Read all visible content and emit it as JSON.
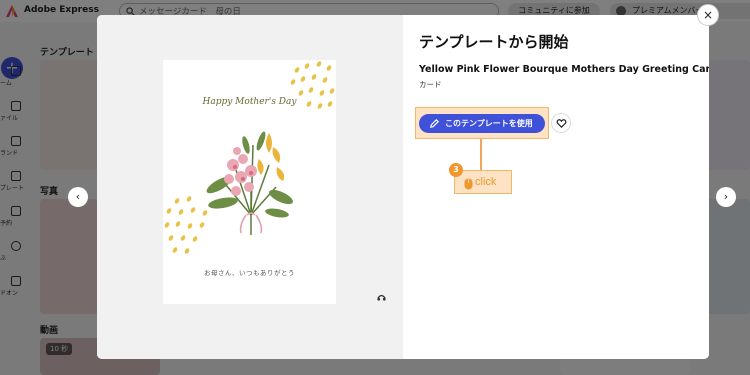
{
  "app": {
    "name": "Adobe Express",
    "search_placeholder": "メッセージカード　母の日",
    "community_label": "コミュニティに参加",
    "premium_label": "プレミアムメンバー",
    "sidebar": {
      "add_label": "+",
      "items": [
        {
          "label": "ホーム",
          "icon": "home-icon"
        },
        {
          "label": "ファイル",
          "icon": "folder-icon"
        },
        {
          "label": "ブランド",
          "icon": "brand-icon"
        },
        {
          "label": "ンプレート",
          "icon": "template-icon"
        },
        {
          "label": "稿予約",
          "icon": "calendar-icon"
        },
        {
          "label": "学ぶ",
          "icon": "bulb-icon"
        },
        {
          "label": "アドオン",
          "icon": "addon-icon"
        }
      ]
    },
    "sections": {
      "templates": "テンプレート",
      "photos": "写真",
      "videos": "動画",
      "video_badge": "10 秒"
    }
  },
  "modal": {
    "heading": "テンプレートから開始",
    "template_name": "Yellow Pink Flower Bourque Mothers Day Greeting Card",
    "template_type": "カード",
    "use_button_label": "このテンプレートを使用",
    "card": {
      "title": "Happy Mother's Day",
      "subtitle": "お母さん、いつもありがとう"
    },
    "close_label": "×",
    "prev_label": "‹",
    "next_label": "›"
  },
  "annotation": {
    "step_number": "3",
    "action_label": "click"
  },
  "colors": {
    "accent": "#3f51d8",
    "annotation": "#f0962d",
    "annotation_fill": "#fde3c4"
  }
}
